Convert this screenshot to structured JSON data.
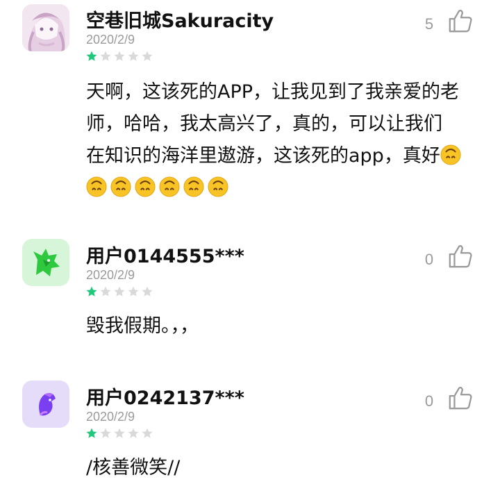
{
  "reviews": [
    {
      "username": "空巷旧城Sakuracity",
      "date": "2020/2/9",
      "rating": 1,
      "max_rating": 5,
      "likes": "5",
      "avatar_icon": "anime-girl-avatar",
      "text_lines": [
        "天啊，这该死的APP，让我见到了我亲爱的老",
        "师，哈哈，我太高兴了，真的，可以让我们",
        "在知识的海洋里遨游，这该死的app，真好"
      ],
      "emoji_name": "upside-down-face-emoji",
      "emoji_count_line3": 1,
      "emoji_count_line4": 6
    },
    {
      "username": "用户0144555***",
      "date": "2020/2/9",
      "rating": 1,
      "max_rating": 5,
      "likes": "0",
      "avatar_icon": "green-wolf-avatar",
      "text": "毁我假期。，，"
    },
    {
      "username": "用户0242137***",
      "date": "2020/2/9",
      "rating": 1,
      "max_rating": 5,
      "likes": "0",
      "avatar_icon": "purple-horse-avatar",
      "text": "/核善微笑//"
    }
  ],
  "colors": {
    "star_filled": "#1fc87a",
    "star_empty": "#d9d9d9",
    "muted_text": "#9a9a9a"
  }
}
